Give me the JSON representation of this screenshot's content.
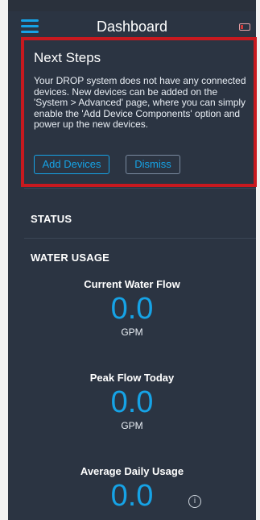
{
  "header": {
    "title": "Dashboard",
    "menu_icon": "hamburger-menu-icon",
    "battery_icon": "battery-low-icon",
    "accent_color": "#16a3e6",
    "battery_color": "#d23a3a"
  },
  "next_steps": {
    "title": "Next Steps",
    "body": "Your DROP system does not have any connected devices.  New devices can be added on the 'System > Advanced' page, where you can simply enable the 'Add Device Components' option and power up the new devices.",
    "add_devices_label": "Add Devices",
    "dismiss_label": "Dismiss",
    "highlight_color": "#c8191f"
  },
  "sections": {
    "status_label": "STATUS",
    "water_usage_label": "WATER USAGE"
  },
  "metrics": [
    {
      "title": "Current Water Flow",
      "value": "0.0",
      "unit": "GPM"
    },
    {
      "title": "Peak Flow Today",
      "value": "0.0",
      "unit": "GPM"
    },
    {
      "title": "Average Daily Usage",
      "value": "0.0"
    }
  ],
  "info_icon": "info-circle-icon"
}
